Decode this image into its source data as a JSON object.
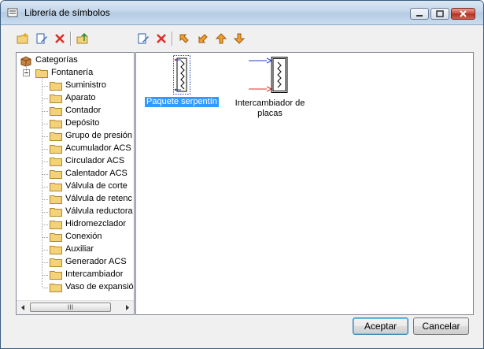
{
  "window": {
    "title": "Librería de símbolos",
    "controls": [
      "minimize",
      "maximize",
      "close"
    ]
  },
  "toolbar_left": {
    "icons": [
      "new-folder-icon",
      "edit-icon",
      "delete-icon",
      "open-folder-up-icon"
    ]
  },
  "toolbar_right": {
    "icons": [
      "edit-icon",
      "delete-icon",
      "move-up-left-icon",
      "move-down-left-icon",
      "arrow-up-icon",
      "arrow-down-icon"
    ]
  },
  "tree": {
    "root": "Categorías",
    "group": "Fontanería",
    "items": [
      "Suministro",
      "Aparato",
      "Contador",
      "Depósito",
      "Grupo de presión",
      "Acumulador ACS",
      "Circulador ACS",
      "Calentador ACS",
      "Válvula de corte",
      "Válvula de retenc",
      "Válvula reductora",
      "Hidromezclador",
      "Conexión",
      "Auxiliar",
      "Generador ACS",
      "Intercambiador",
      "Vaso de expansió"
    ],
    "scrollbar_thumb": "III"
  },
  "symbols": [
    {
      "label": "Paquete serpentín",
      "selected": true
    },
    {
      "label_line1": "Intercambiador de",
      "label_line2": "placas",
      "selected": false
    }
  ],
  "buttons": {
    "ok": "Aceptar",
    "cancel": "Cancelar"
  },
  "colors": {
    "selection": "#3399ff",
    "delete_red": "#d8312a",
    "folder_yellow": "#f3d27a",
    "symbol_blue": "#1f3fbf",
    "symbol_red": "#d8312a"
  }
}
